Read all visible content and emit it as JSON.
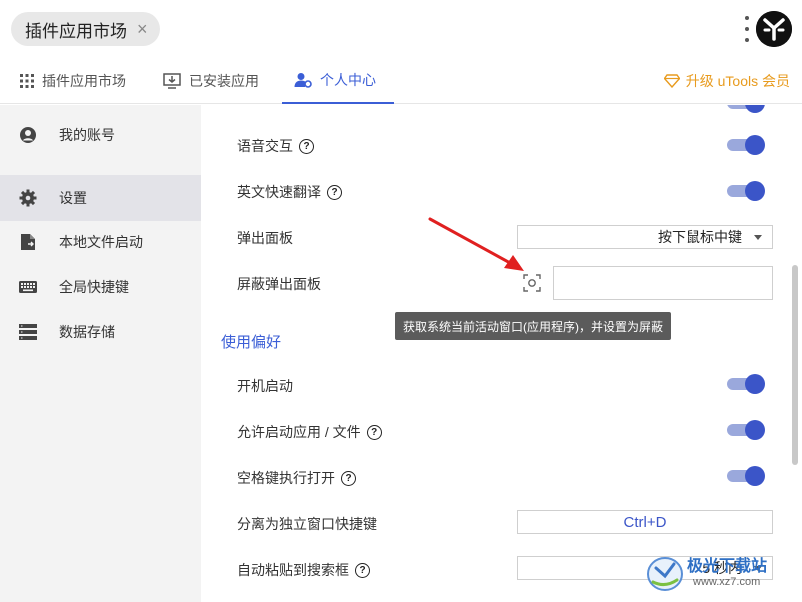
{
  "search": {
    "plugin_chip": "插件应用市场",
    "close_glyph": "×"
  },
  "tabs": [
    {
      "label": "插件应用市场",
      "icon": "grid-icon"
    },
    {
      "label": "已安装应用",
      "icon": "download-monitor-icon"
    },
    {
      "label": "个人中心",
      "icon": "user-gear-icon",
      "active": true
    }
  ],
  "upgrade": {
    "label": "升级 uTools 会员",
    "icon": "diamond-icon",
    "color": "#e89b1e"
  },
  "sidebar": {
    "items": [
      {
        "label": "我的账号",
        "icon": "account-icon"
      },
      {
        "label": "设置",
        "icon": "gear-icon",
        "active": true
      },
      {
        "label": "本地文件启动",
        "icon": "file-icon"
      },
      {
        "label": "全局快捷键",
        "icon": "keyboard-icon"
      },
      {
        "label": "数据存储",
        "icon": "storage-icon"
      }
    ]
  },
  "settings": {
    "voice": {
      "label": "语音交互",
      "help": "?",
      "enabled": true
    },
    "translate": {
      "label": "英文快速翻译",
      "help": "?",
      "enabled": true
    },
    "popup_panel": {
      "label": "弹出面板",
      "value": "按下鼠标中键"
    },
    "block_popup": {
      "label": "屏蔽弹出面板",
      "value": ""
    },
    "tooltip": "获取系统当前活动窗口(应用程序)，并设置为屏蔽",
    "section_prefs": "使用偏好",
    "autostart": {
      "label": "开机启动",
      "enabled": true
    },
    "allow_launch": {
      "label": "允许启动应用 / 文件",
      "help": "?",
      "enabled": true
    },
    "space_open": {
      "label": "空格键执行打开",
      "help": "?",
      "enabled": true
    },
    "detach_shortcut": {
      "label": "分离为独立窗口快捷键",
      "value": "Ctrl+D"
    },
    "auto_paste": {
      "label": "自动粘贴到搜索框",
      "help": "?",
      "value": "5 秒内"
    }
  },
  "watermark": {
    "text_main": "极光下载站",
    "text_sub": "www.xz7.com"
  },
  "colors": {
    "accent": "#3b5ed6",
    "toggle_knob": "#3b55c8",
    "toggle_track": "#9aa8dc",
    "upgrade": "#e89b1e",
    "arrow": "#e02020"
  }
}
